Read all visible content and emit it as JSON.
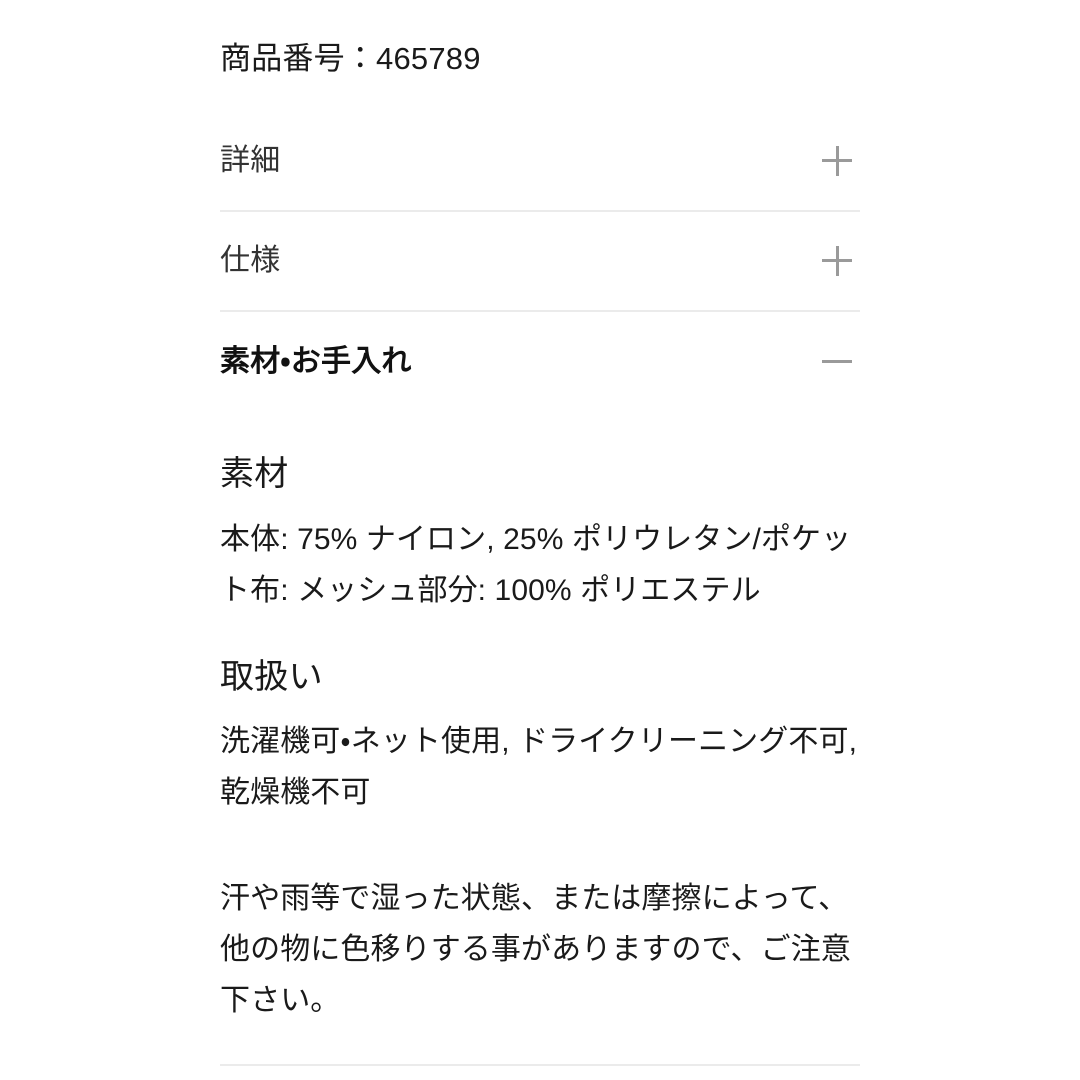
{
  "product_number": {
    "label": "商品番号：465789"
  },
  "accordion": {
    "items": [
      {
        "label": "詳細",
        "icon": "plus-icon",
        "expanded": false
      },
      {
        "label": "仕様",
        "icon": "plus-icon",
        "expanded": false
      },
      {
        "label": "素材・お手入れ",
        "icon": "minus-icon",
        "expanded": true
      }
    ]
  },
  "material_care_panel": {
    "material": {
      "heading": "素材",
      "text": "本体: 75% ナイロン, 25% ポリウレタン/ポケット布: メッシュ部分: 100% ポリエステル"
    },
    "care": {
      "heading": "取扱い",
      "text": "洗濯機可・ネット使用, ドライクリーニング不可, 乾燥機不可",
      "note": "汗や雨等で湿った状態、または摩擦によって、他の物に色移りする事がありますので、ご注意下さい。"
    }
  },
  "colors": {
    "text": "#1a1a1a",
    "row_label": "#333333",
    "icon": "#9a9a9a",
    "divider": "#ebebeb",
    "background": "#ffffff"
  }
}
